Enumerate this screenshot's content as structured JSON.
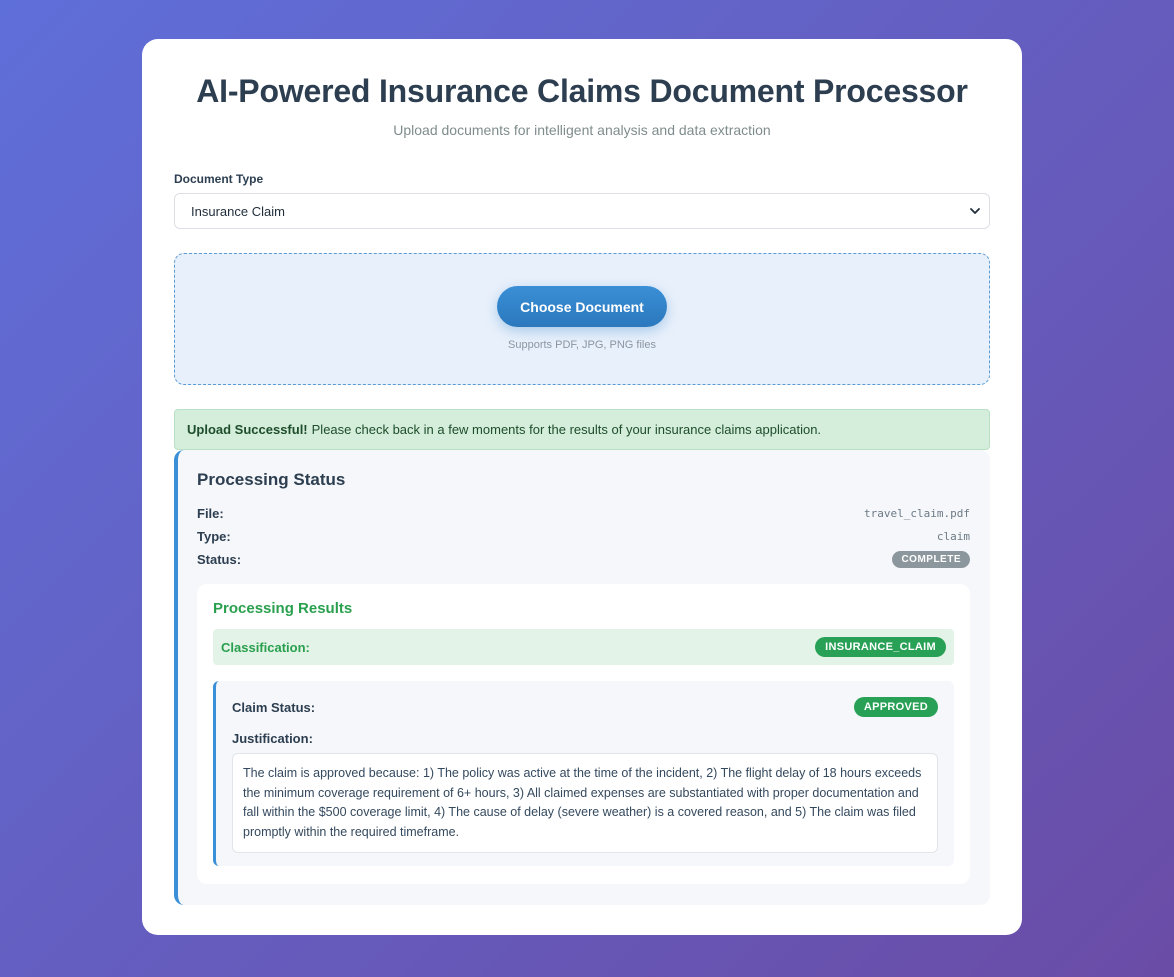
{
  "header": {
    "title": "AI-Powered Insurance Claims Document Processor",
    "subtitle": "Upload documents for intelligent analysis and data extraction"
  },
  "document_type": {
    "label": "Document Type",
    "selected": "Insurance Claim"
  },
  "upload": {
    "button_label": "Choose Document",
    "supports_text": "Supports PDF, JPG, PNG files"
  },
  "alert": {
    "strong": "Upload Successful!",
    "message": "Please check back in a few moments for the results of your insurance claims application."
  },
  "status": {
    "title": "Processing Status",
    "file_label": "File:",
    "file_value": "travel_claim.pdf",
    "type_label": "Type:",
    "type_value": "claim",
    "status_label": "Status:",
    "status_value": "COMPLETE"
  },
  "results": {
    "title": "Processing Results",
    "classification_label": "Classification:",
    "classification_value": "INSURANCE_CLAIM",
    "claim_status_label": "Claim Status:",
    "claim_status_value": "APPROVED",
    "justification_label": "Justification:",
    "justification_text": "The claim is approved because: 1) The policy was active at the time of the incident, 2) The flight delay of 18 hours exceeds the minimum coverage requirement of 6+ hours, 3) All claimed expenses are substantiated with proper documentation and fall within the $500 coverage limit, 4) The cause of delay (severe weather) is a covered reason, and 5) The claim was filed promptly within the required timeframe."
  },
  "colors": {
    "accent": "#3a8fd6",
    "success": "#28a055",
    "neutral_badge": "#8c979d"
  },
  "icons": {
    "select_chevron": "chevron-down-icon"
  }
}
